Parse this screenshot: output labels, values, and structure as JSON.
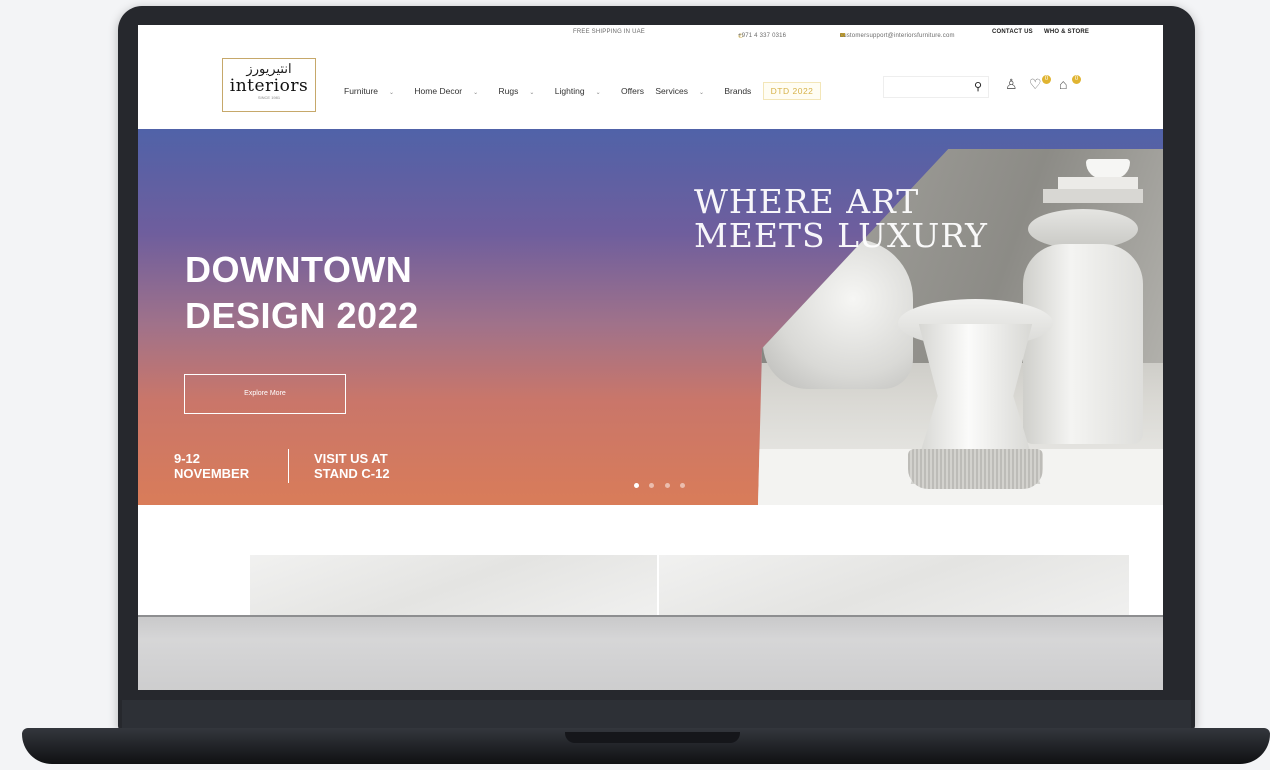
{
  "topbar": {
    "shipping": "FREE SHIPPING IN UAE",
    "phone": "+971 4 337 0316",
    "email": "customersupport@interiorsfurniture.com",
    "contact": "CONTACT US",
    "who": "WHO & STORE"
  },
  "logo": {
    "arabic": "انتيريورز",
    "english": "interiors",
    "since": "SINCE 1981"
  },
  "nav": {
    "items": [
      "Furniture",
      "Home Decor",
      "Rugs",
      "Lighting",
      "Offers",
      "Services",
      "Brands"
    ],
    "promo": "DTD 2022"
  },
  "header_icons": {
    "search": "search-icon",
    "account": "user-icon",
    "wishlist": "heart-icon",
    "wishlist_count": "0",
    "cart": "bag-icon",
    "cart_count": "0"
  },
  "hero": {
    "title_line1": "DOWNTOWN",
    "title_line2": "DESIGN 2022",
    "tagline_line1": "WHERE ART",
    "tagline_line2": "MEETS LUXURY",
    "button": "Explore More",
    "date_line1": "9-12",
    "date_line2": "NOVEMBER",
    "visit_line1": "VISIT US AT",
    "visit_line2": "STAND C-12",
    "slides": 4,
    "active_slide": 1
  },
  "colors": {
    "accent": "#e0b431",
    "gradient_top": "#5062a8",
    "gradient_bottom": "#d97c59"
  }
}
